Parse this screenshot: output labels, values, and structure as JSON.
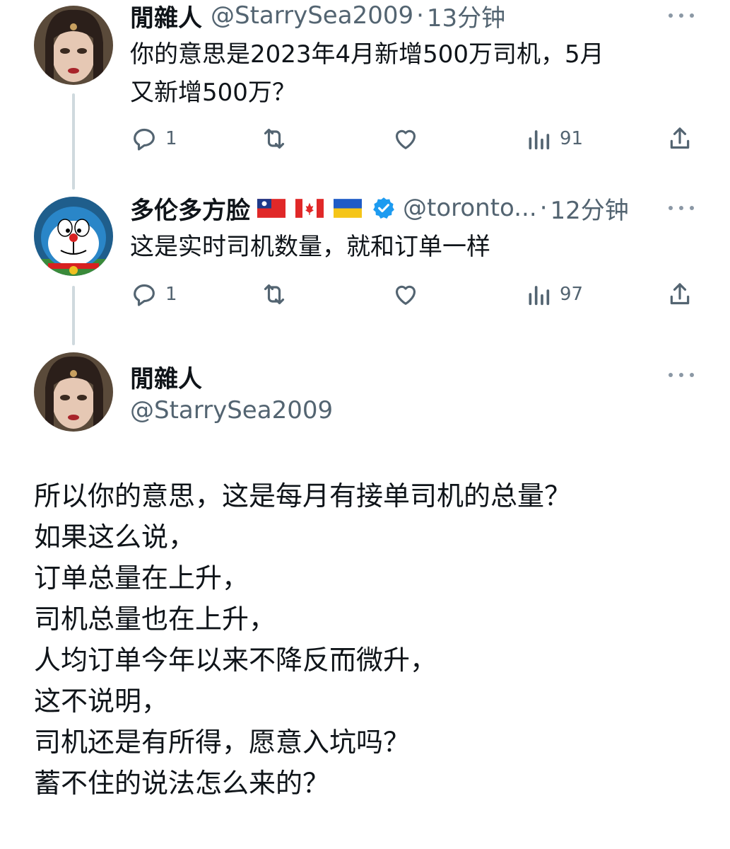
{
  "tweet1": {
    "author_name": "閒雜人",
    "handle": "@StarrySea2009",
    "separator": "·",
    "time": "13分钟",
    "text_lines": [
      "你的意思是2023年4月新增500万司机，5月",
      "又新增500万？"
    ],
    "reply_count": "1",
    "view_count": "91"
  },
  "tweet2": {
    "author_name": "多伦多方脸",
    "handle": "@toronto...",
    "separator": "·",
    "time": "12分钟",
    "text": "这是实时司机数量，就和订单一样",
    "reply_count": "1",
    "view_count": "97"
  },
  "main_tweet": {
    "author_name": "閒雜人",
    "handle": "@StarrySea2009",
    "body_lines": [
      "所以你的意思，这是每月有接单司机的总量？",
      "如果这么说，",
      "订单总量在上升，",
      "司机总量也在上升，",
      "人均订单今年以来不降反而微升，",
      "这不说明，",
      "司机还是有所得，愿意入坑吗？",
      "蓄不住的说法怎么来的？"
    ]
  },
  "colors": {
    "text": "#0f1419",
    "secondary": "#536471",
    "thread_line": "#cfd9de",
    "verified": "#1d9bf0"
  },
  "icons": [
    "reply-icon",
    "retweet-icon",
    "like-icon",
    "views-icon",
    "share-icon",
    "more-icon",
    "verified-icon"
  ]
}
